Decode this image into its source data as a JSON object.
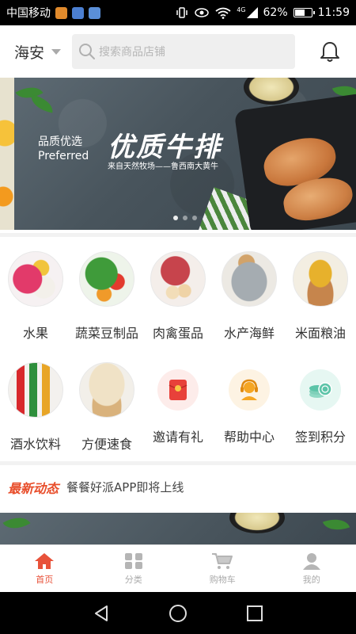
{
  "status_bar": {
    "carrier": "中国移动",
    "network": "4G",
    "battery": "62%",
    "battery_level": 0.62,
    "time": "11:59"
  },
  "header": {
    "city": "海安",
    "search_placeholder": "搜索商品店铺"
  },
  "banner": {
    "subtitle_cn": "品质优选",
    "subtitle_en": "Preferred",
    "title": "优质牛排",
    "tagline": "来自天然牧场——鲁西南大黄牛",
    "slide_count": 3,
    "active_slide": 0
  },
  "categories": [
    {
      "label": "水果",
      "icon": "fruit-icon"
    },
    {
      "label": "蔬菜豆制品",
      "icon": "vegetables-icon"
    },
    {
      "label": "肉禽蛋品",
      "icon": "meat-eggs-icon"
    },
    {
      "label": "水产海鲜",
      "icon": "seafood-icon"
    },
    {
      "label": "米面粮油",
      "icon": "grain-oil-icon"
    },
    {
      "label": "酒水饮料",
      "icon": "drinks-icon"
    },
    {
      "label": "方便速食",
      "icon": "instant-food-icon"
    },
    {
      "label": "邀请有礼",
      "icon": "red-envelope-icon",
      "color": "#e8413a",
      "bg": "#fdecea"
    },
    {
      "label": "帮助中心",
      "icon": "customer-service-icon",
      "color": "#f5a623",
      "bg": "#fdf3e3"
    },
    {
      "label": "签到积分",
      "icon": "coins-icon",
      "color": "#5cc4a8",
      "bg": "#e6f7f2"
    }
  ],
  "news": {
    "tag": "最新动态",
    "message": "餐餐好派APP即将上线"
  },
  "tabs": [
    {
      "label": "首页",
      "icon": "home-icon",
      "active": true
    },
    {
      "label": "分类",
      "icon": "grid-icon",
      "active": false
    },
    {
      "label": "购物车",
      "icon": "cart-icon",
      "active": false
    },
    {
      "label": "我的",
      "icon": "user-icon",
      "active": false
    }
  ],
  "colors": {
    "accent": "#e8523a",
    "news_tag": "#e84e2b"
  }
}
